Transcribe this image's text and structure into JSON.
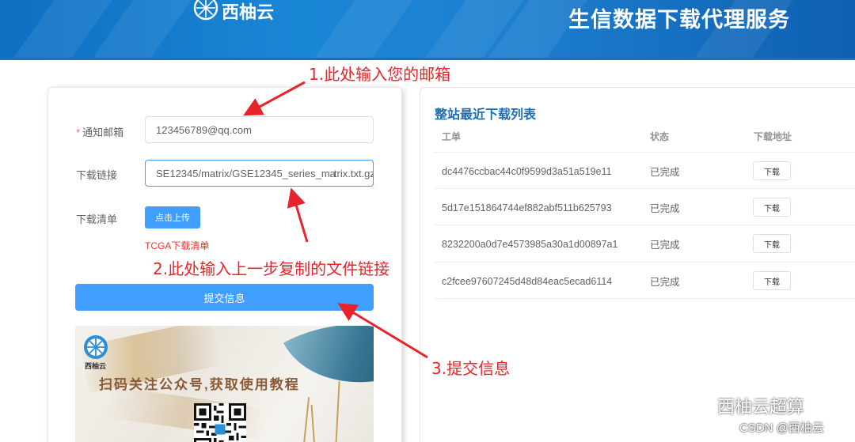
{
  "header": {
    "brand_name": "西柚云",
    "banner_title": "生信数据下载代理服务"
  },
  "form": {
    "email_label": "通知邮箱",
    "required_mark": "*",
    "email_value": "123456789@qq.com",
    "link_label": "下载链接",
    "link_value_before_cursor": "SE12345/matrix/GSE12345_series_ma",
    "link_value_after_cursor": "trix.txt.gz",
    "list_label": "下载清单",
    "upload_button": "点击上传",
    "tcga_link": "TCGA下载清单",
    "submit_button": "提交信息"
  },
  "promo": {
    "brand": "西柚云",
    "slogan": "扫码关注公众号,获取使用教程"
  },
  "downloads": {
    "title": "整站最近下载列表",
    "columns": [
      "工单",
      "状态",
      "下载地址"
    ],
    "rows": [
      {
        "ticket": "dc4476ccbac44c0f9599d3a51a519e11",
        "status": "已完成",
        "action": "下载"
      },
      {
        "ticket": "5d17e151864744ef882abf511b625793",
        "status": "已完成",
        "action": "下载"
      },
      {
        "ticket": "8232200a0d7e4573985a30a1d00897a1",
        "status": "已完成",
        "action": "下载"
      },
      {
        "ticket": "c2fcee97607245d48d84eac5ecad6114",
        "status": "已完成",
        "action": "下载"
      }
    ]
  },
  "annotations": {
    "step1": "1.此处输入您的邮箱",
    "step2": "2.此处输入上一步复制的文件链接",
    "step3": "3.提交信息",
    "color": "#e8232a"
  },
  "watermark": {
    "account": "西柚云超算",
    "csdn": "CSDN @西柚云"
  },
  "colors": {
    "primary": "#409eff",
    "title_blue": "#1e6fb3",
    "header_blue": "#1a86d6",
    "danger": "#f03030"
  }
}
